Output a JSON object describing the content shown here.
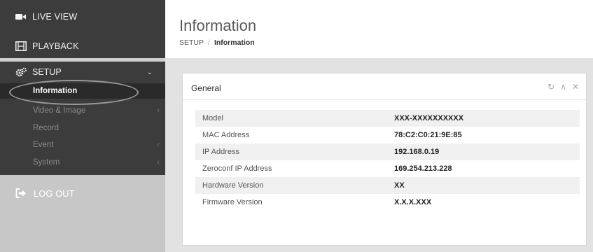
{
  "sidebar": {
    "live_view": {
      "label": "LIVE VIEW",
      "icon": "video-camera-icon"
    },
    "playback": {
      "label": "PLAYBACK",
      "icon": "film-icon"
    },
    "setup": {
      "label": "SETUP",
      "icon": "gears-icon",
      "items": [
        {
          "label": "Information",
          "active": true
        },
        {
          "label": "Video & Image",
          "has_submenu": true
        },
        {
          "label": "Record"
        },
        {
          "label": "Event",
          "has_submenu": true
        },
        {
          "label": "System",
          "has_submenu": true
        }
      ]
    },
    "logout": {
      "label": "LOG OUT",
      "icon": "sign-out-icon"
    }
  },
  "header": {
    "title": "Information",
    "breadcrumb": {
      "root": "SETUP",
      "separator": "/",
      "current": "Information"
    }
  },
  "panel": {
    "title": "General",
    "tools": [
      "refresh-icon",
      "collapse-icon",
      "close-icon"
    ],
    "rows": [
      {
        "key": "Model",
        "value": "XXX-XXXXXXXXXX"
      },
      {
        "key": "MAC Address",
        "value": "78:C2:C0:21:9E:85"
      },
      {
        "key": "IP Address",
        "value": "192.168.0.19"
      },
      {
        "key": "Zeroconf IP Address",
        "value": "169.254.213.228"
      },
      {
        "key": "Hardware Version",
        "value": "XX"
      },
      {
        "key": "Firmware Version",
        "value": "X.X.X.XXX"
      }
    ]
  },
  "colors": {
    "sidebar_dark": "#3c3c3c",
    "sidebar_active": "#2a2a2a",
    "sidebar_light": "#cfcfcf",
    "content_bg": "#e2e2e2",
    "panel_bg": "#ffffff"
  }
}
